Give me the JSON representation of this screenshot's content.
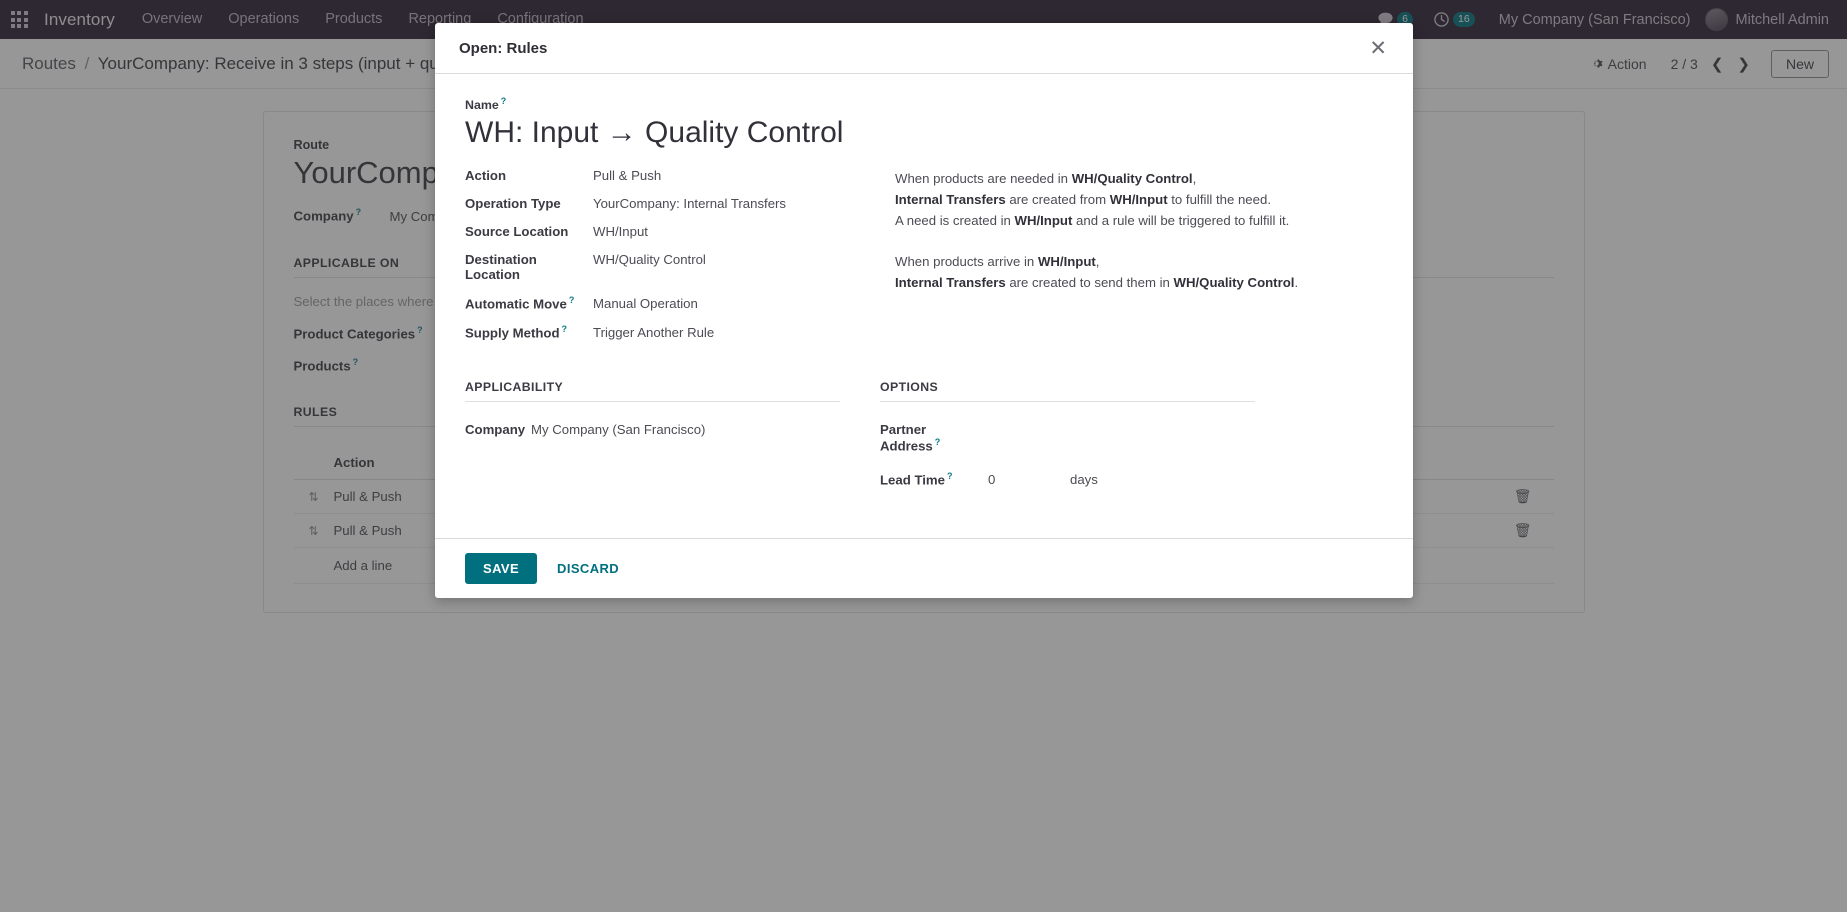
{
  "navbar": {
    "apps_icon": "apps-grid-icon",
    "brand": "Inventory",
    "menu": [
      "Overview",
      "Operations",
      "Products",
      "Reporting",
      "Configuration"
    ],
    "messages_icon": "chat-bubble-icon",
    "messages_count": "6",
    "activities_icon": "clock-icon",
    "activities_count": "16",
    "company": "My Company (San Francisco)",
    "user": "Mitchell Admin"
  },
  "control_panel": {
    "breadcrumb_root": "Routes",
    "breadcrumb_sep": "/",
    "breadcrumb_current": "YourCompany: Receive in 3 steps (input + quality + stock)",
    "action_icon": "gear-icon",
    "action_label": "Action",
    "pager": "2 / 3",
    "prev_icon": "chevron-left-icon",
    "next_icon": "chevron-right-icon",
    "new_label": "New"
  },
  "background_form": {
    "route_label": "Route",
    "route_name": "YourCompany: Receive in 3 steps (input + quality + stock)",
    "company_label": "Company",
    "company_value": "My Company (San Francisco)",
    "applicable_on_title": "APPLICABLE ON",
    "applicable_note": "Select the places where this route can be selected",
    "product_categories_label": "Product Categories",
    "products_label": "Products",
    "rules_title": "RULES",
    "rules_col_action": "Action",
    "rules_rows": [
      {
        "action": "Pull & Push"
      },
      {
        "action": "Pull & Push"
      }
    ],
    "add_a_line": "Add a line",
    "trash_icon": "trash-icon",
    "drag_icon": "drag-handle-icon"
  },
  "modal": {
    "title": "Open: Rules",
    "close_icon": "close-icon",
    "name_label": "Name",
    "name_value": "WH: Input → Quality Control",
    "fields": [
      {
        "label": "Action",
        "value": "Pull & Push",
        "help": false
      },
      {
        "label": "Operation Type",
        "value": "YourCompany: Internal Transfers",
        "help": false
      },
      {
        "label": "Source Location",
        "value": "WH/Input",
        "help": false
      },
      {
        "label": "Destination Location",
        "value": "WH/Quality Control",
        "help": false
      },
      {
        "label": "Automatic Move",
        "value": "Manual Operation",
        "help": true
      },
      {
        "label": "Supply Method",
        "value": "Trigger Another Rule",
        "help": true
      }
    ],
    "description": {
      "block1": [
        [
          {
            "t": "When products are needed in ",
            "b": false
          },
          {
            "t": "WH/Quality Control",
            "b": true
          },
          {
            "t": ",",
            "b": false
          }
        ],
        [
          {
            "t": "Internal Transfers",
            "b": true
          },
          {
            "t": " are created from ",
            "b": false
          },
          {
            "t": "WH/Input",
            "b": true
          },
          {
            "t": " to fulfill the need.",
            "b": false
          }
        ],
        [
          {
            "t": "A need is created in ",
            "b": false
          },
          {
            "t": "WH/Input",
            "b": true
          },
          {
            "t": " and a rule will be triggered to fulfill it.",
            "b": false
          }
        ]
      ],
      "block2": [
        [
          {
            "t": "When products arrive in ",
            "b": false
          },
          {
            "t": "WH/Input",
            "b": true
          },
          {
            "t": ",",
            "b": false
          }
        ],
        [
          {
            "t": "Internal Transfers",
            "b": true
          },
          {
            "t": " are created to send them in ",
            "b": false
          },
          {
            "t": "WH/Quality Control",
            "b": true
          },
          {
            "t": ".",
            "b": false
          }
        ]
      ]
    },
    "applicability": {
      "title": "APPLICABILITY",
      "company_label": "Company",
      "company_value": "My Company (San Francisco)"
    },
    "options": {
      "title": "OPTIONS",
      "partner_address_label": "Partner Address",
      "partner_address_value": "",
      "lead_time_label": "Lead Time",
      "lead_time_value": "0",
      "lead_time_unit": "days"
    },
    "save_label": "SAVE",
    "discard_label": "DISCARD"
  },
  "colors": {
    "navbar_bg": "#2b2033",
    "accent": "#00707f",
    "help_link": "#0d7a87",
    "backdrop": "rgba(47,47,47,0.50)"
  }
}
